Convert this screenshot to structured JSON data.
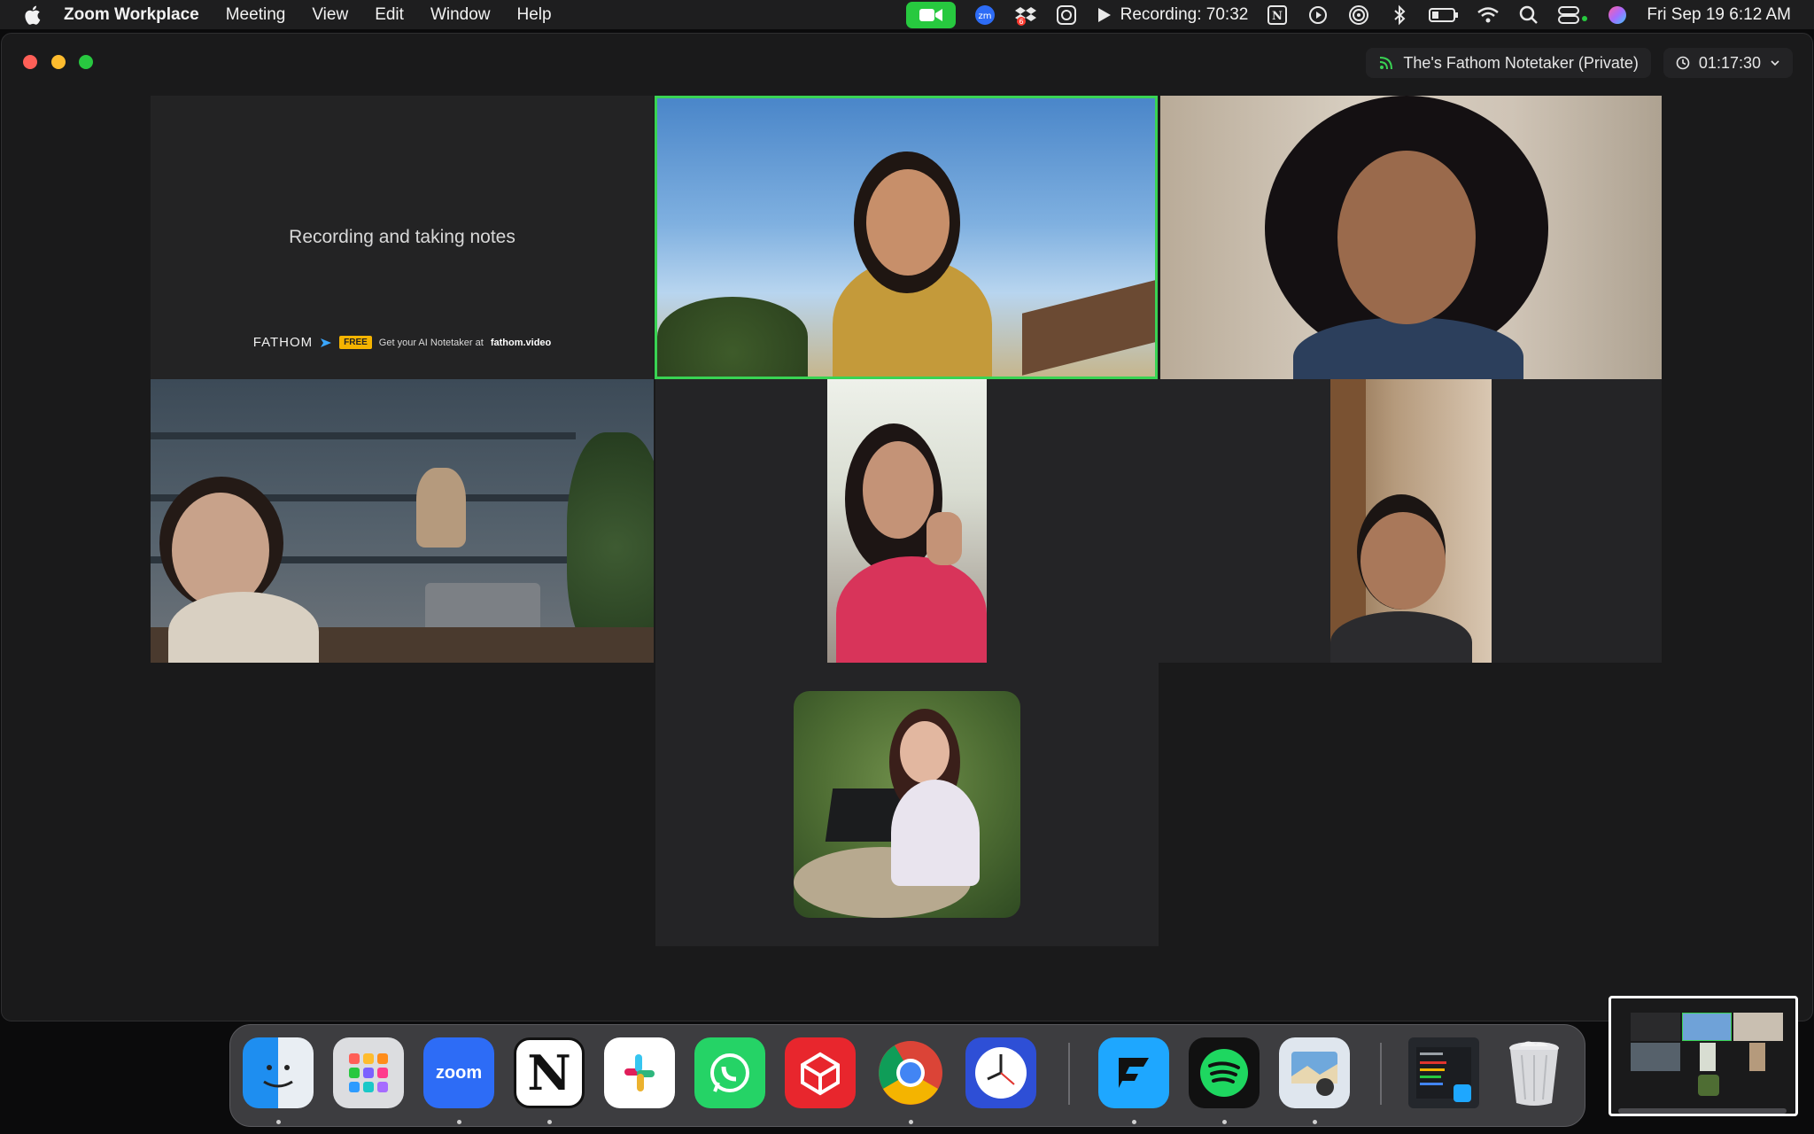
{
  "menubar": {
    "app_name": "Zoom Workplace",
    "menus": [
      "Meeting",
      "View",
      "Edit",
      "Window",
      "Help"
    ],
    "recording_label": "Recording: 70:32",
    "datetime": "Fri Sep 19  6:12 AM",
    "zoom_badge": "zm",
    "notification_count": "6",
    "notion_glyph": "N"
  },
  "window": {
    "notetaker_name": "The's Fathom Notetaker (Private)",
    "meeting_timer": "01:17:30"
  },
  "fathom_tile": {
    "status_text": "Recording and taking notes",
    "brand": "FATHOM",
    "badge": "FREE",
    "promo_text": "Get your AI Notetaker at",
    "promo_link": "fathom.video"
  },
  "dock": {
    "apps": [
      {
        "name": "Finder",
        "icon": "finder-icon"
      },
      {
        "name": "Launchpad",
        "icon": "launchpad-icon"
      },
      {
        "name": "zoom",
        "icon": "zoom-icon"
      },
      {
        "name": "N",
        "icon": "notion-icon"
      },
      {
        "name": "Slack",
        "icon": "slack-icon"
      },
      {
        "name": "WhatsApp",
        "icon": "whatsapp-icon"
      },
      {
        "name": "RoboForm",
        "icon": "roboform-icon"
      },
      {
        "name": "Chrome",
        "icon": "chrome-icon"
      },
      {
        "name": "Clock",
        "icon": "clock-icon"
      },
      {
        "name": "Fathom",
        "icon": "fathom-icon"
      },
      {
        "name": "Spotify",
        "icon": "spotify-icon"
      },
      {
        "name": "Preview",
        "icon": "preview-icon"
      },
      {
        "name": "Stacks",
        "icon": "stacks-icon"
      },
      {
        "name": "Trash",
        "icon": "trash-icon"
      }
    ]
  },
  "colors": {
    "active_speaker": "#39d353",
    "camera_indicator": "#27c93f",
    "window_bg": "#1a1a1b"
  }
}
